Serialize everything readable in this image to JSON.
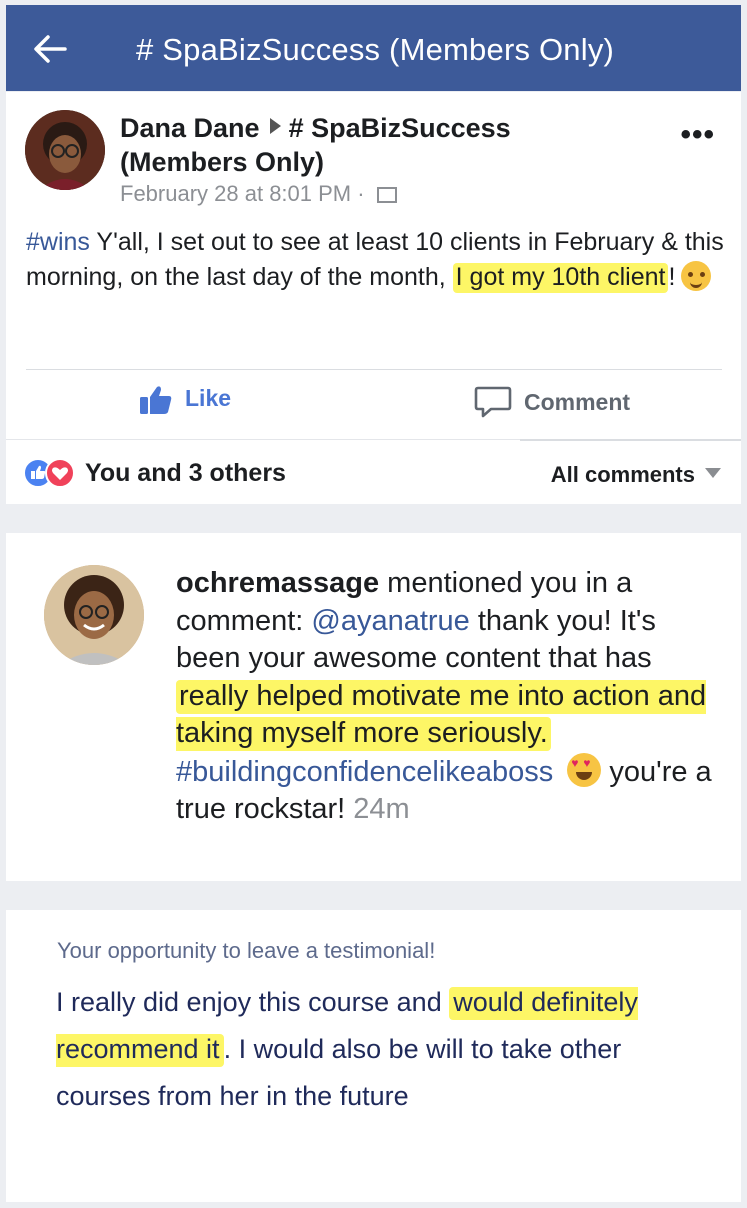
{
  "header": {
    "title": "# SpaBizSuccess (Members Only)"
  },
  "post": {
    "author": "Dana Dane",
    "group_first": "# SpaBizSuccess",
    "group_cont": "(Members Only)",
    "timestamp": "February 28 at 8:01 PM ·",
    "hashtag": "#wins",
    "text_1": " Y'all, I set out to see at least 10 clients in February & this morning, on the last day of the month,",
    "text_highlight": "I got my 10th client",
    "text_end": "!",
    "like_label": "Like",
    "comment_label": "Comment",
    "reactions_text": "You and 3 others",
    "all_comments_label": "All comments"
  },
  "notification": {
    "name": "ochremassage",
    "text_1": " mentioned you in a comment: ",
    "mention": "@ayanatrue",
    "text_2": " thank you! It's been your awesome content that has ",
    "highlight": "really helped motivate me into action and taking myself more seriously.",
    "hashtag": "#buildingconfidencelikeaboss",
    "text_3": "you're a true rockstar! ",
    "time": "24m"
  },
  "testimonial": {
    "label": "Your opportunity to leave a testimonial!",
    "text_1": "I really did enjoy this course and ",
    "highlight": "would definitely recommend it",
    "text_2": ". I would also be will to take other courses from her in the future"
  },
  "colors": {
    "header_bg": "#3d5a99",
    "link": "#385898",
    "highlight": "#fdf666",
    "like_blue": "#4a76d4"
  },
  "icons": [
    "back-arrow-icon",
    "group-privacy-icon",
    "more-options-icon",
    "thumbs-up-icon",
    "comment-bubble-icon",
    "like-reaction-icon",
    "love-reaction-icon",
    "dropdown-caret-icon",
    "party-face-emoji",
    "heart-eyes-emoji"
  ]
}
